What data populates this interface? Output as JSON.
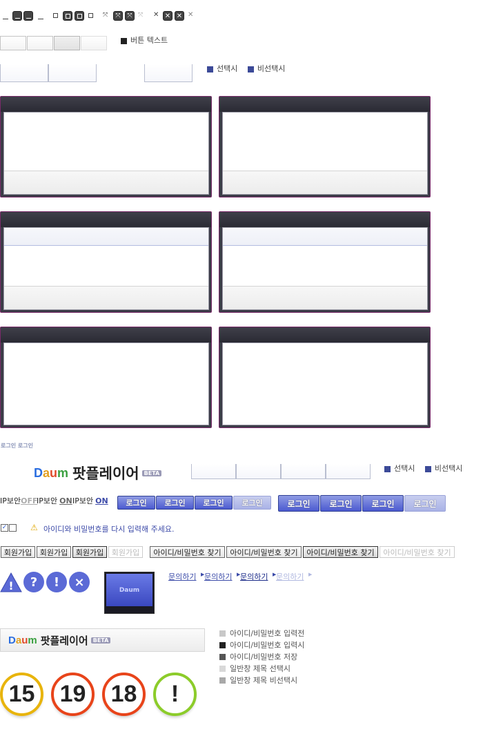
{
  "sample_button": {
    "text": "버튼 텍스트"
  },
  "tab_legend": {
    "selected": "선택시",
    "unselected": "비선택시"
  },
  "small_login_text": "로그인 로그인",
  "logo": {
    "text": "팟플레이어",
    "beta": "BETA"
  },
  "logo_legend": {
    "selected": "선택시",
    "unselected": "비선택시"
  },
  "ip_security": [
    {
      "label": "IP보안",
      "state": "OFF"
    },
    {
      "label": "IP보안",
      "state": "ON"
    },
    {
      "label": "IP보안",
      "state": "ON"
    }
  ],
  "login_buttons_small": [
    "로그인",
    "로그인",
    "로그인",
    "로그인"
  ],
  "login_buttons_large": [
    "로그인",
    "로그인",
    "로그인",
    "로그인"
  ],
  "error_message": "아이디와 비밀번호를 다시 입력해 주세요.",
  "join_buttons": [
    "회원가입",
    "회원가입",
    "회원가입",
    "회원가입"
  ],
  "find_buttons": [
    "아이디/비밀번호 찾기",
    "아이디/비밀번호 찾기",
    "아이디/비밀번호 찾기",
    "아이디/비밀번호 찾기"
  ],
  "inquiry_links": [
    "문의하기",
    "문의하기",
    "문의하기",
    "문의하기"
  ],
  "status_icons": {
    "question": "?",
    "exclaim": "!",
    "close": "×"
  },
  "swatches": [
    {
      "label": "아이디/비밀번호 입력전",
      "color": "#c8c8c8"
    },
    {
      "label": "아이디/비밀번호 입력시",
      "color": "#222222"
    },
    {
      "label": "아이디/비밀번호 저장",
      "color": "#555555"
    },
    {
      "label": "일반창 제목 선택시",
      "color": "#d8d8d8"
    },
    {
      "label": "일반창 제목 비선택시",
      "color": "#a8a8a8"
    }
  ],
  "ratings": [
    {
      "label": "15",
      "color": "#e8b40c"
    },
    {
      "label": "19",
      "color": "#e8441a"
    },
    {
      "label": "18",
      "color": "#e8441a"
    },
    {
      "label": "!",
      "color": "#8ccc2a"
    }
  ],
  "colors": {
    "accent": "#3c4a98",
    "window_border": "#7a2a6a"
  }
}
